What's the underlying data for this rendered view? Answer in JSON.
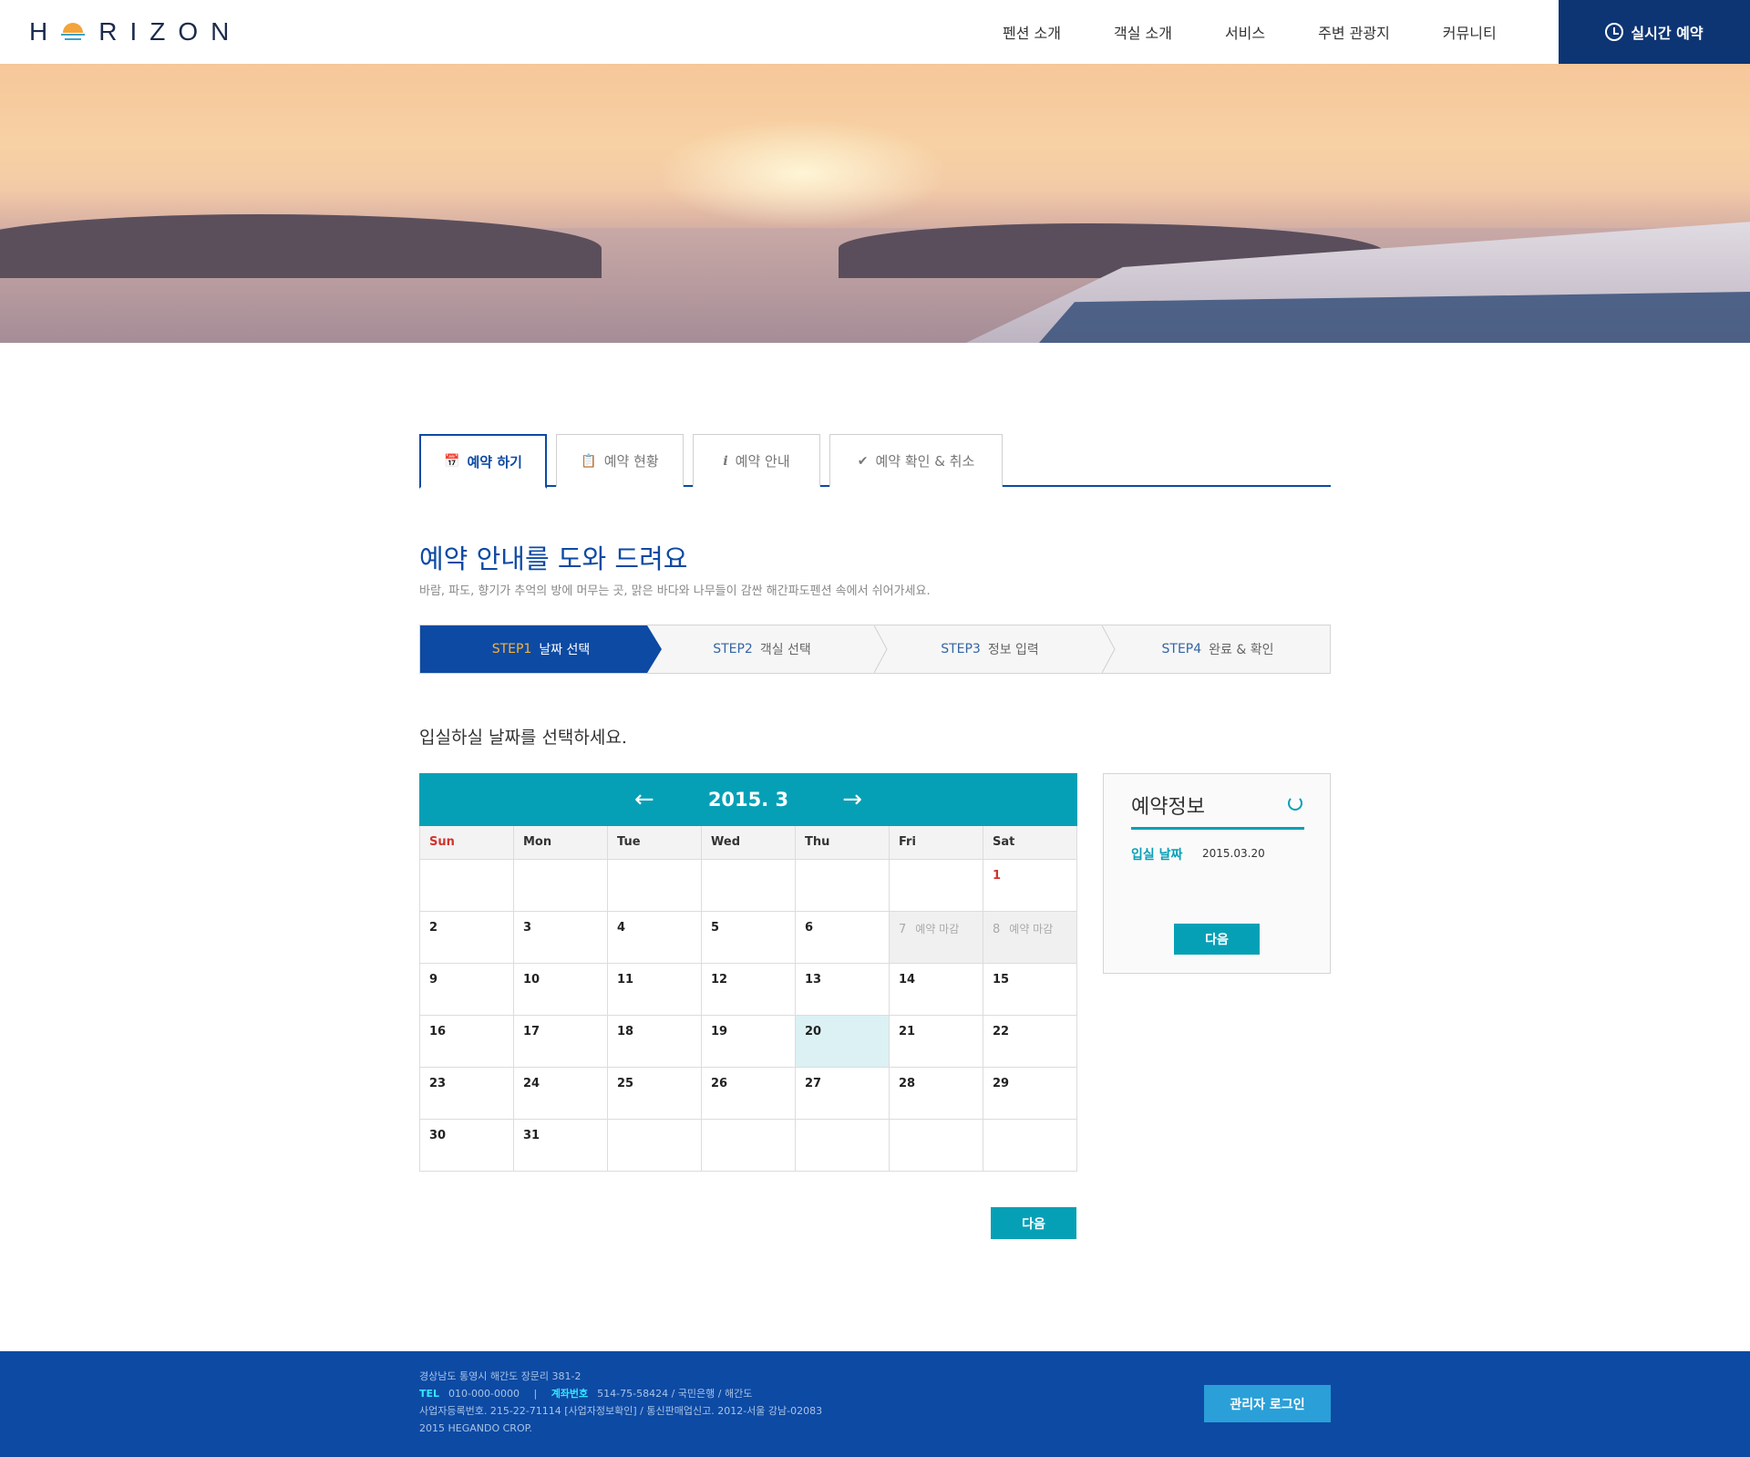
{
  "header": {
    "logo_text": "HORIZON",
    "nav": [
      "펜션 소개",
      "객실 소개",
      "서비스",
      "주변 관광지",
      "커뮤니티"
    ],
    "realtime_label": "실시간 예약"
  },
  "tabs": [
    {
      "label": "예약 하기",
      "icon": "calendar-icon",
      "active": true
    },
    {
      "label": "예약 현황",
      "icon": "clipboard-icon",
      "active": false
    },
    {
      "label": "예약 안내",
      "icon": "info-icon",
      "active": false
    },
    {
      "label": "예약 확인 & 취소",
      "icon": "check-circle-icon",
      "active": false
    }
  ],
  "page": {
    "title": "예약 안내를 도와 드려요",
    "subtitle": "바람, 파도, 향기가 추억의 방에 머무는 곳, 맑은 바다와 나무들이 감싼 해간파도펜션 속에서 쉬어가세요.",
    "prompt": "입실하실 날짜를 선택하세요."
  },
  "steps": [
    {
      "num": "STEP1",
      "label": "날짜 선택",
      "active": true
    },
    {
      "num": "STEP2",
      "label": "객실 선택",
      "active": false
    },
    {
      "num": "STEP3",
      "label": "정보 입력",
      "active": false
    },
    {
      "num": "STEP4",
      "label": "완료 & 확인",
      "active": false
    }
  ],
  "calendar": {
    "month_label": "2015. 3",
    "weekdays": [
      "Sun",
      "Mon",
      "Tue",
      "Wed",
      "Thu",
      "Fri",
      "Sat"
    ],
    "weeks": [
      [
        "",
        "",
        "",
        "",
        "",
        "",
        "1"
      ],
      [
        "2",
        "3",
        "4",
        "5",
        "6",
        "7",
        "8"
      ],
      [
        "9",
        "10",
        "11",
        "12",
        "13",
        "14",
        "15"
      ],
      [
        "16",
        "17",
        "18",
        "19",
        "20",
        "21",
        "22"
      ],
      [
        "23",
        "24",
        "25",
        "26",
        "27",
        "28",
        "29"
      ],
      [
        "30",
        "31",
        "",
        "",
        "",
        "",
        ""
      ]
    ],
    "closed_label": "예약 마감",
    "closed_days": [
      "7",
      "8"
    ],
    "selected_day": "20",
    "next_label": "다음"
  },
  "info": {
    "title": "예약정보",
    "checkin_label": "입실 날짜",
    "checkin_value": "2015.03.20",
    "next_label": "다음"
  },
  "footer": {
    "address": "경상남도 통영시 해간도 장문리 381-2",
    "tel_label": "TEL",
    "tel": "010-000-0000",
    "separator": "|",
    "account_label": "계좌번호",
    "account": "514-75-58424 / 국민은행 / 해간도",
    "biz": "사업자등록번호. 215-22-71114 [사업자정보확인] / 통신판매업신고. 2012-서울 강남-02083",
    "copyright": "2015 HEGANDO CROP.",
    "admin_label": "관리자 로그인"
  },
  "colors": {
    "navy": "#0d3573",
    "blue": "#0d4aa3",
    "teal": "#06a0b6",
    "orange": "#f5b33d",
    "red": "#d0342c"
  }
}
